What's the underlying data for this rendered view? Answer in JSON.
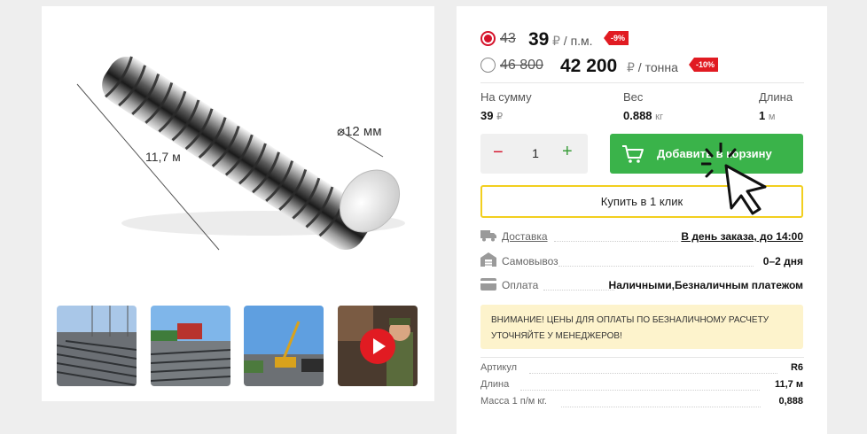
{
  "product": {
    "dimension_length": "11,7 м",
    "dimension_diameter": "⌀12 мм"
  },
  "thumbnails": [
    {
      "name": "thumb-rebar-stack-1"
    },
    {
      "name": "thumb-rebar-stack-2"
    },
    {
      "name": "thumb-crane-yard"
    },
    {
      "name": "thumb-video-manager",
      "icon": "play-icon"
    }
  ],
  "prices": {
    "per_meter": {
      "old": "43",
      "new": "39",
      "currency": "₽",
      "unit": " / п.м.",
      "discount": "-9%"
    },
    "per_ton": {
      "old": "46 800",
      "new": "42 200",
      "currency": "₽",
      "unit": " / тонна",
      "discount": "-10%"
    }
  },
  "summary": {
    "sum_label": "На сумму",
    "sum_value": "39",
    "sum_unit": "₽",
    "weight_label": "Вес",
    "weight_value": "0.888",
    "weight_unit": "кг",
    "length_label": "Длина",
    "length_value": "1",
    "length_unit": "м"
  },
  "quantity": {
    "minus": "−",
    "value": "1",
    "plus": "+"
  },
  "actions": {
    "add_to_cart": "Добавить в корзину",
    "buy_one_click": "Купить в 1 клик"
  },
  "delivery": [
    {
      "icon": "truck-icon",
      "label": "Доставка",
      "value": "В день заказа, до 14:00"
    },
    {
      "icon": "warehouse-icon",
      "label": "Самовывоз",
      "value": "0–2 дня"
    },
    {
      "icon": "card-icon",
      "label": "Оплата",
      "value": "Наличными,Безналичным платежом"
    }
  ],
  "notice": "ВНИМАНИЕ! ЦЕНЫ ДЛЯ ОПЛАТЫ ПО БЕЗНАЛИЧНОМУ РАСЧЕТУ УТОЧНЯЙТЕ У МЕНЕДЖЕРОВ!",
  "specs": [
    {
      "label": "Артикул",
      "value": "R6"
    },
    {
      "label": "Длина",
      "value": "11,7 м"
    },
    {
      "label": "Масса 1 п/м кг.",
      "value": "0,888"
    }
  ],
  "colors": {
    "accent_red": "#e11b22",
    "cta_green": "#3ab34a",
    "outline_yellow": "#f2cf1f",
    "notice_bg": "#fdf3cc"
  }
}
